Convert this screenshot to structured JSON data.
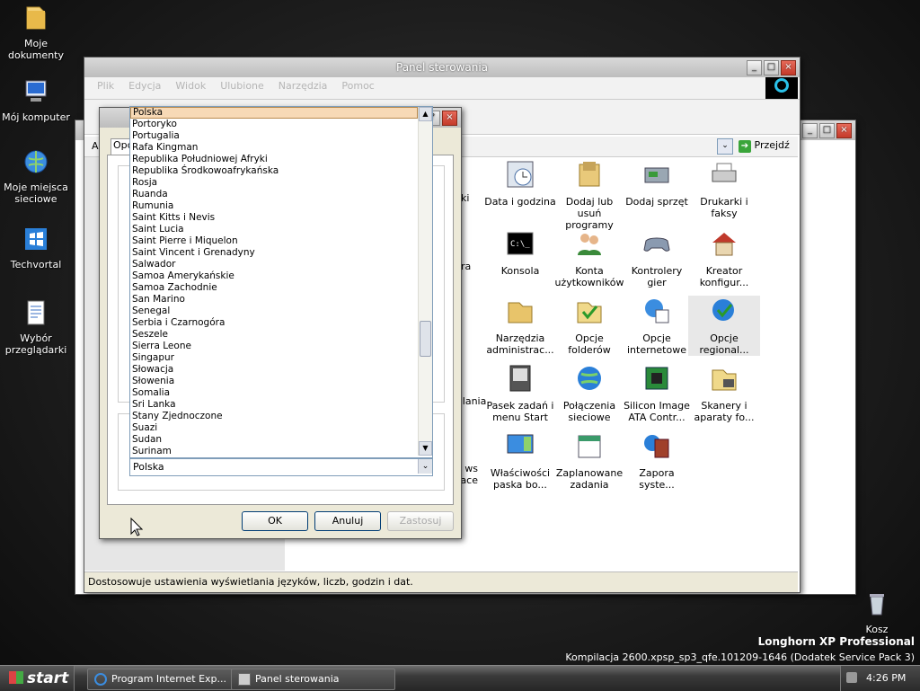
{
  "desktop_icons": [
    {
      "label": "Moje dokumenty",
      "icon": "folder-icon"
    },
    {
      "label": "Mój komputer",
      "icon": "computer-icon"
    },
    {
      "label": "Moje miejsca sieciowe",
      "icon": "network-icon"
    },
    {
      "label": "Techvortal",
      "icon": "windows-shortcut-icon"
    },
    {
      "label": "Wybór przeglądarki",
      "icon": "document-shortcut-icon"
    },
    {
      "label": "Kosz",
      "icon": "recycle-bin-icon"
    }
  ],
  "branding": {
    "edition": "Longhorn XP Professional",
    "build": "Kompilacja 2600.xpsp_sp3_qfe.101209-1646 (Dodatek Service Pack 3)"
  },
  "control_panel": {
    "title": "Panel sterowania",
    "menu": [
      "Plik",
      "Edycja",
      "Widok",
      "Ulubione",
      "Narzędzia",
      "Pomoc"
    ],
    "go_label": "Przejdź",
    "address_prefix": "A",
    "status": "Dostosowuje ustawienia wyświetlania języków, liczb, godzin i dat.",
    "items": [
      {
        "label": "Data i godzina",
        "icon": "clock-icon"
      },
      {
        "label": "Dodaj lub usuń programy",
        "icon": "add-remove-programs-icon"
      },
      {
        "label": "Dodaj sprzęt",
        "icon": "add-hardware-icon"
      },
      {
        "label": "Drukarki i faksy",
        "icon": "printer-icon"
      },
      {
        "label": "Konsola",
        "icon": "console-icon"
      },
      {
        "label": "Konta użytkowników",
        "icon": "users-icon"
      },
      {
        "label": "Kontrolery gier",
        "icon": "gamepad-icon"
      },
      {
        "label": "Kreator konfigur...",
        "icon": "house-icon"
      },
      {
        "label": "Narzędzia administrac...",
        "icon": "admin-tools-icon"
      },
      {
        "label": "Opcje folderów",
        "icon": "folder-options-icon"
      },
      {
        "label": "Opcje internetowe",
        "icon": "internet-options-icon"
      },
      {
        "label": "Opcje regional...",
        "icon": "regional-options-icon"
      },
      {
        "label": "Pasek zadań i menu Start",
        "icon": "taskbar-icon"
      },
      {
        "label": "Połączenia sieciowe",
        "icon": "globe-icon"
      },
      {
        "label": "Silicon Image ATA Contr...",
        "icon": "chip-icon"
      },
      {
        "label": "Skanery i aparaty fo...",
        "icon": "scanner-icon"
      },
      {
        "label": "Właściwości paska bo...",
        "icon": "sidebar-icon"
      },
      {
        "label": "Zaplanowane zadania",
        "icon": "calendar-icon"
      },
      {
        "label": "Zapora syste...",
        "icon": "firewall-icon"
      }
    ],
    "partial_left": [
      "nki",
      "ura",
      "z",
      "silania",
      "ws\nace"
    ]
  },
  "dialog": {
    "tab_label": "Opc",
    "countries": [
      "Polska",
      "Portoryko",
      "Portugalia",
      "Rafa Kingman",
      "Republika Południowej Afryki",
      "Republika Środkowoafrykańska",
      "Rosja",
      "Ruanda",
      "Rumunia",
      "Saint Kitts i Nevis",
      "Saint Lucia",
      "Saint Pierre i Miquelon",
      "Saint Vincent i Grenadyny",
      "Salwador",
      "Samoa Amerykańskie",
      "Samoa Zachodnie",
      "San Marino",
      "Senegal",
      "Serbia i Czarnogóra",
      "Seszele",
      "Sierra Leone",
      "Singapur",
      "Słowacja",
      "Słowenia",
      "Somalia",
      "Sri Lanka",
      "Stany Zjednoczone",
      "Suazi",
      "Sudan",
      "Surinam"
    ],
    "selected_value": "Polska",
    "ok_label": "OK",
    "cancel_label": "Anuluj",
    "apply_label": "Zastosuj"
  },
  "taskbar": {
    "start_label": "start",
    "tasks": [
      {
        "label": "Program Internet Exp...",
        "icon": "ie-icon"
      },
      {
        "label": "Panel sterowania",
        "icon": "control-panel-icon"
      }
    ],
    "clock": "4:26 PM"
  }
}
